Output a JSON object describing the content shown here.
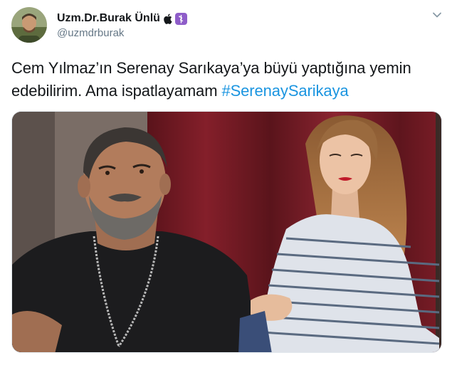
{
  "author": {
    "display_name": "Uzm.Dr.Burak Ünlü",
    "handle": "@uzmdrburak",
    "icons": [
      "apple-icon",
      "staff-of-asclepius-icon"
    ]
  },
  "tweet": {
    "text": "Cem Yılmaz’ın Serenay Sarıkaya’ya büyü yaptığına yemin edebilirim. Ama ispatlayamam ",
    "hashtag": "#SerenaySarikaya"
  },
  "media": {
    "kind": "photo"
  },
  "colors": {
    "link": "#1b95e0",
    "text": "#14171a",
    "secondary": "#657786",
    "badge": "#8e5dc9"
  }
}
